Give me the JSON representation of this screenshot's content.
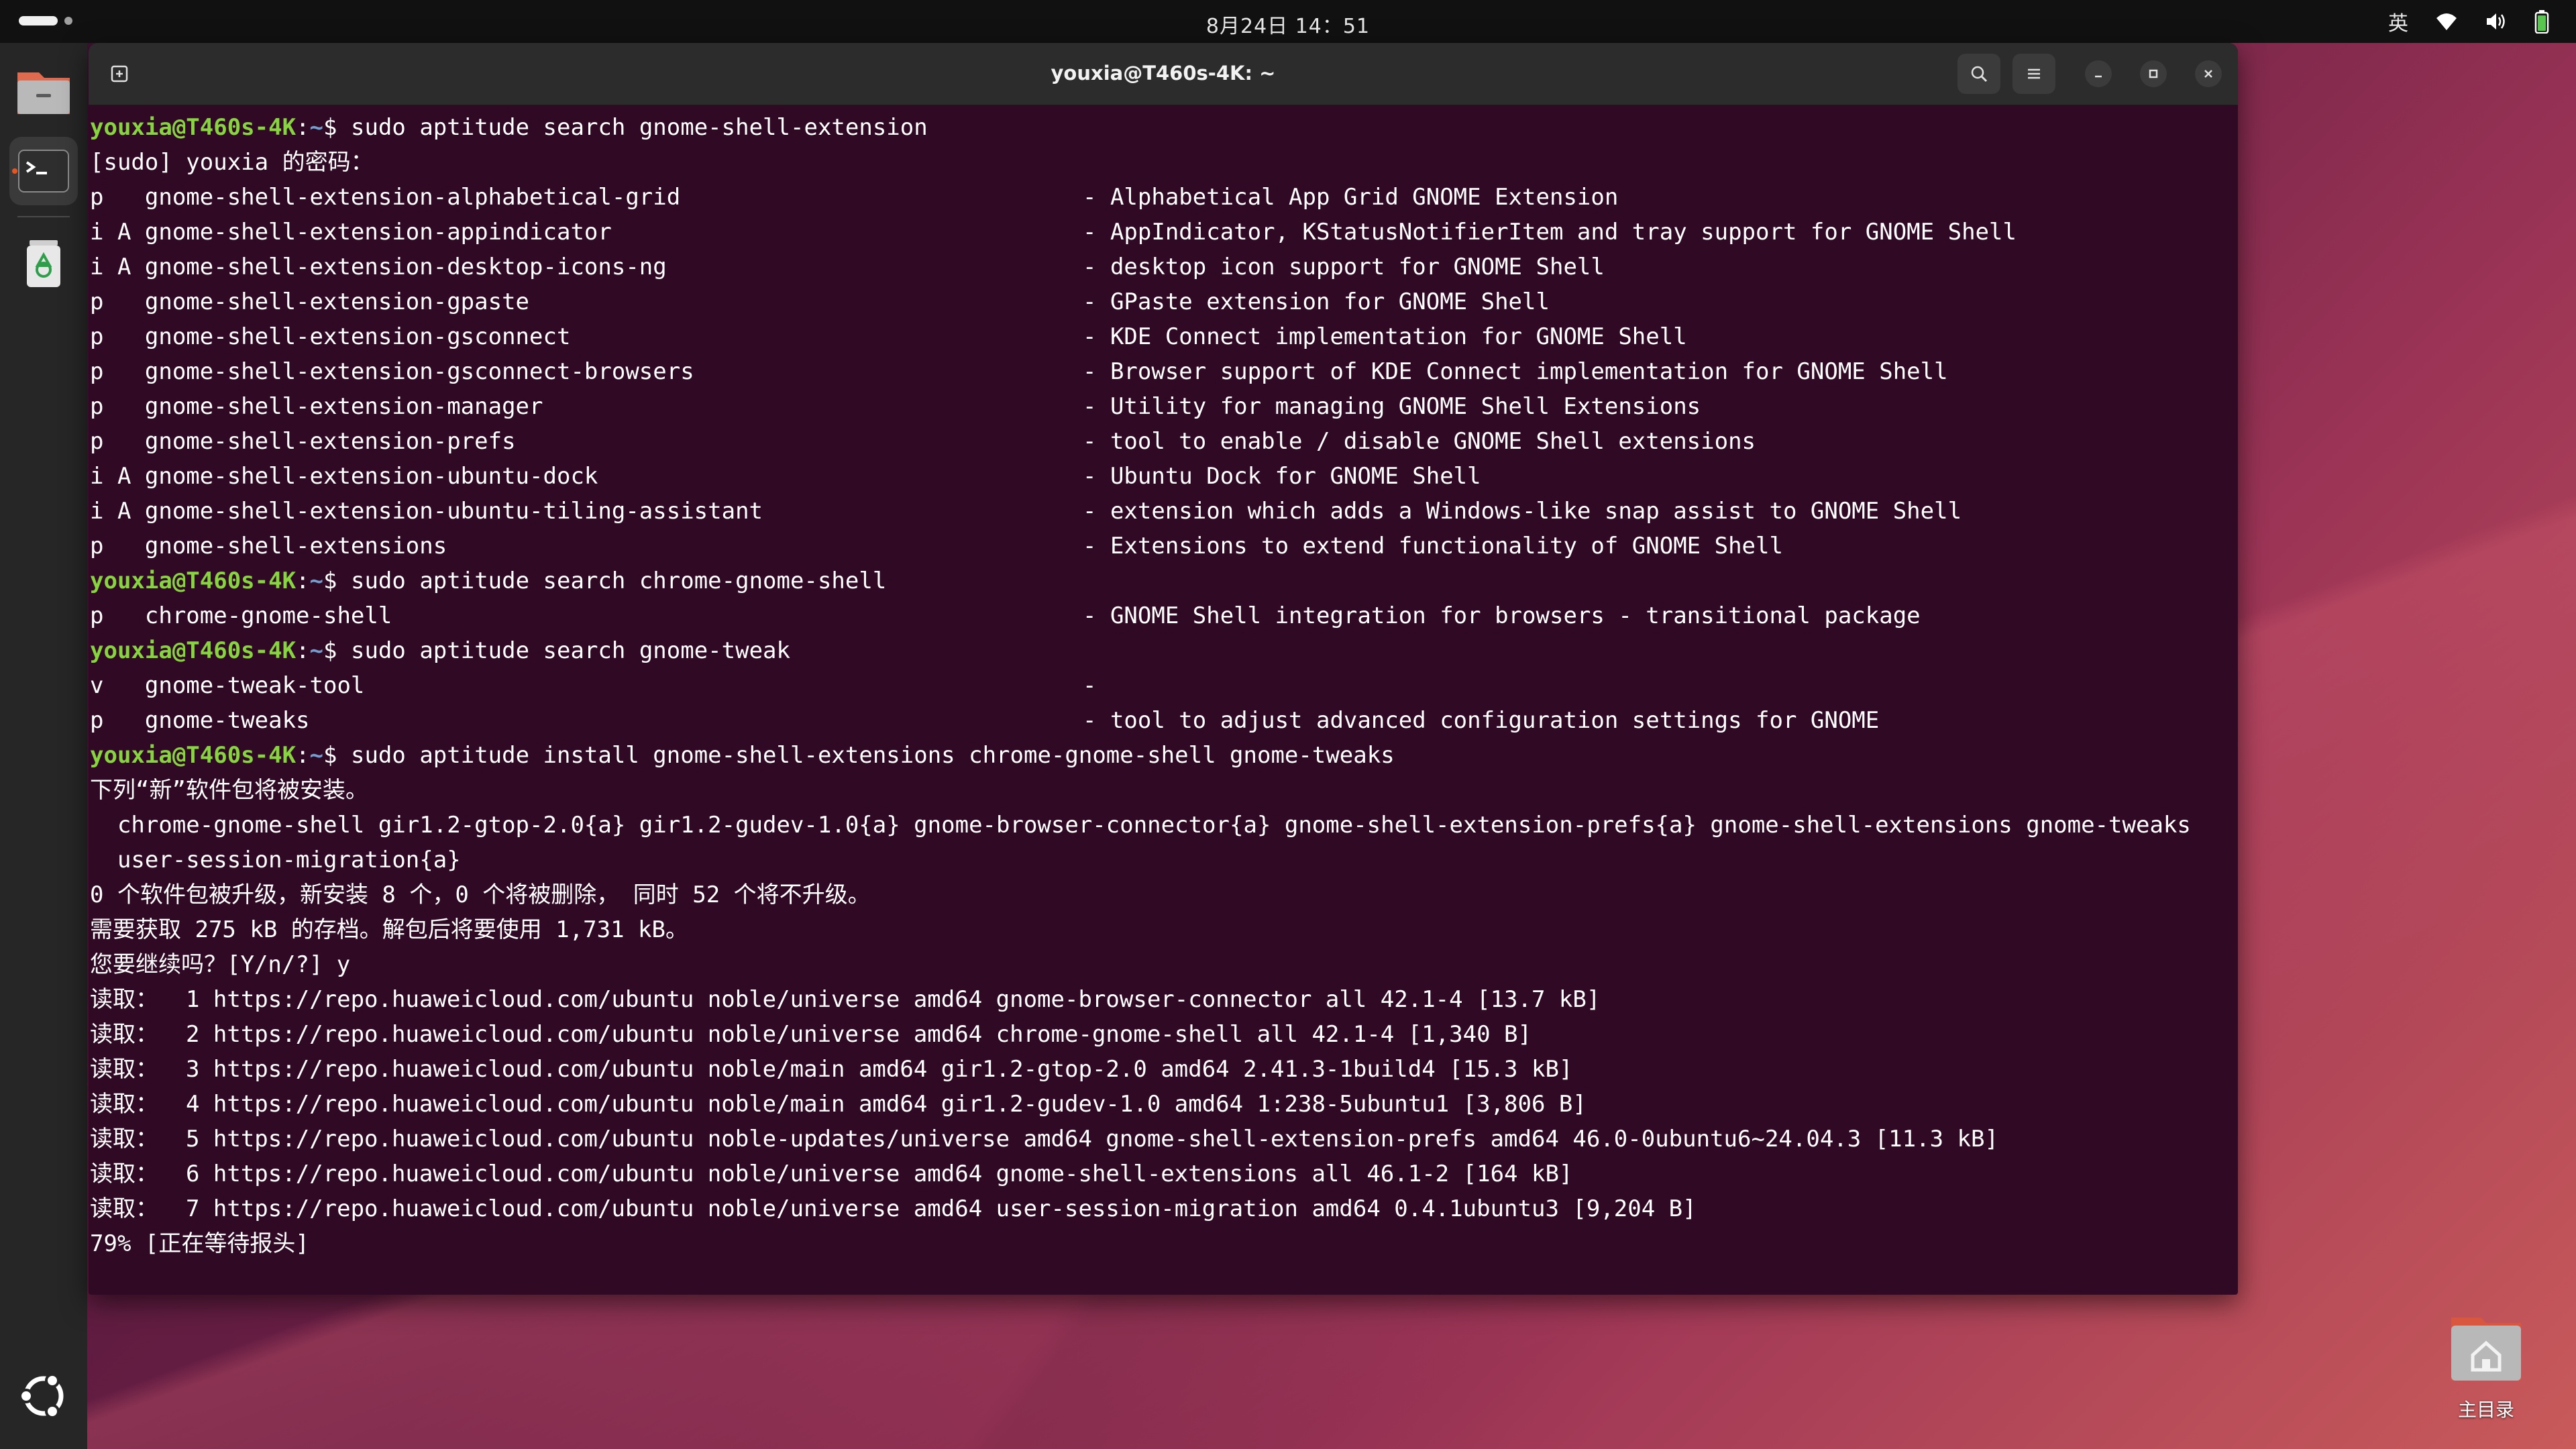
{
  "topbar": {
    "clock": "8月24日 14：51",
    "input_method": "英"
  },
  "window": {
    "title": "youxia@T460s-4K: ~"
  },
  "prompt": {
    "user": "youxia@T460s-4K",
    "sep": ":",
    "path": "~",
    "symbol": "$ "
  },
  "terminal": {
    "lines": [
      {
        "type": "prompt",
        "cmd": "sudo aptitude search gnome-shell-extension"
      },
      {
        "type": "text",
        "text": "[sudo] youxia 的密码："
      },
      {
        "type": "pkg",
        "left": "p   gnome-shell-extension-alphabetical-grid",
        "right": "- Alphabetical App Grid GNOME Extension"
      },
      {
        "type": "pkg",
        "left": "i A gnome-shell-extension-appindicator",
        "right": "- AppIndicator, KStatusNotifierItem and tray support for GNOME Shell"
      },
      {
        "type": "pkg",
        "left": "i A gnome-shell-extension-desktop-icons-ng",
        "right": "- desktop icon support for GNOME Shell"
      },
      {
        "type": "pkg",
        "left": "p   gnome-shell-extension-gpaste",
        "right": "- GPaste extension for GNOME Shell"
      },
      {
        "type": "pkg",
        "left": "p   gnome-shell-extension-gsconnect",
        "right": "- KDE Connect implementation for GNOME Shell"
      },
      {
        "type": "pkg",
        "left": "p   gnome-shell-extension-gsconnect-browsers",
        "right": "- Browser support of KDE Connect implementation for GNOME Shell"
      },
      {
        "type": "pkg",
        "left": "p   gnome-shell-extension-manager",
        "right": "- Utility for managing GNOME Shell Extensions"
      },
      {
        "type": "pkg",
        "left": "p   gnome-shell-extension-prefs",
        "right": "- tool to enable / disable GNOME Shell extensions"
      },
      {
        "type": "pkg",
        "left": "i A gnome-shell-extension-ubuntu-dock",
        "right": "- Ubuntu Dock for GNOME Shell"
      },
      {
        "type": "pkg",
        "left": "i A gnome-shell-extension-ubuntu-tiling-assistant",
        "right": "- extension which adds a Windows-like snap assist to GNOME Shell"
      },
      {
        "type": "pkg",
        "left": "p   gnome-shell-extensions",
        "right": "- Extensions to extend functionality of GNOME Shell"
      },
      {
        "type": "prompt",
        "cmd": "sudo aptitude search chrome-gnome-shell"
      },
      {
        "type": "pkg",
        "left": "p   chrome-gnome-shell",
        "right": "- GNOME Shell integration for browsers - transitional package"
      },
      {
        "type": "prompt",
        "cmd": "sudo aptitude search gnome-tweak"
      },
      {
        "type": "pkg",
        "left": "v   gnome-tweak-tool",
        "right": "-"
      },
      {
        "type": "pkg",
        "left": "p   gnome-tweaks",
        "right": "- tool to adjust advanced configuration settings for GNOME"
      },
      {
        "type": "prompt",
        "cmd": "sudo aptitude install gnome-shell-extensions chrome-gnome-shell gnome-tweaks"
      },
      {
        "type": "text",
        "text": "下列“新”软件包将被安装。"
      },
      {
        "type": "text",
        "text": "  chrome-gnome-shell gir1.2-gtop-2.0{a} gir1.2-gudev-1.0{a} gnome-browser-connector{a} gnome-shell-extension-prefs{a} gnome-shell-extensions gnome-tweaks"
      },
      {
        "type": "text",
        "text": "  user-session-migration{a}"
      },
      {
        "type": "text",
        "text": "0 个软件包被升级，新安装 8 个，0 个将被删除， 同时 52 个将不升级。"
      },
      {
        "type": "text",
        "text": "需要获取 275 kB 的存档。解包后将要使用 1,731 kB。"
      },
      {
        "type": "text",
        "text": "您要继续吗？[Y/n/?] y"
      },
      {
        "type": "text",
        "text": "读取：  1 https://repo.huaweicloud.com/ubuntu noble/universe amd64 gnome-browser-connector all 42.1-4 [13.7 kB]"
      },
      {
        "type": "text",
        "text": "读取：  2 https://repo.huaweicloud.com/ubuntu noble/universe amd64 chrome-gnome-shell all 42.1-4 [1,340 B]"
      },
      {
        "type": "text",
        "text": "读取：  3 https://repo.huaweicloud.com/ubuntu noble/main amd64 gir1.2-gtop-2.0 amd64 2.41.3-1build4 [15.3 kB]"
      },
      {
        "type": "text",
        "text": "读取：  4 https://repo.huaweicloud.com/ubuntu noble/main amd64 gir1.2-gudev-1.0 amd64 1:238-5ubuntu1 [3,806 B]"
      },
      {
        "type": "text",
        "text": "读取：  5 https://repo.huaweicloud.com/ubuntu noble-updates/universe amd64 gnome-shell-extension-prefs amd64 46.0-0ubuntu6~24.04.3 [11.3 kB]"
      },
      {
        "type": "text",
        "text": "读取：  6 https://repo.huaweicloud.com/ubuntu noble/universe amd64 gnome-shell-extensions all 46.1-2 [164 kB]"
      },
      {
        "type": "text",
        "text": "读取：  7 https://repo.huaweicloud.com/ubuntu noble/universe amd64 user-session-migration amd64 0.4.1ubuntu3 [9,204 B]"
      },
      {
        "type": "text",
        "text": "79% [正在等待报头]"
      }
    ]
  },
  "desktop": {
    "home_label": "主目录"
  },
  "icons": {
    "dock": [
      "files-icon",
      "terminal-icon",
      "trash-icon",
      "ubuntu-logo-icon"
    ],
    "tray": [
      "wifi-icon",
      "volume-icon",
      "battery-icon"
    ],
    "header": [
      "new-tab-icon",
      "search-icon",
      "menu-icon",
      "minimize-icon",
      "maximize-icon",
      "close-icon"
    ]
  },
  "colors": {
    "terminal_bg": "#300a24",
    "prompt_user": "#87d441",
    "prompt_path": "#729fcf",
    "ubuntu_orange": "#e95420"
  }
}
